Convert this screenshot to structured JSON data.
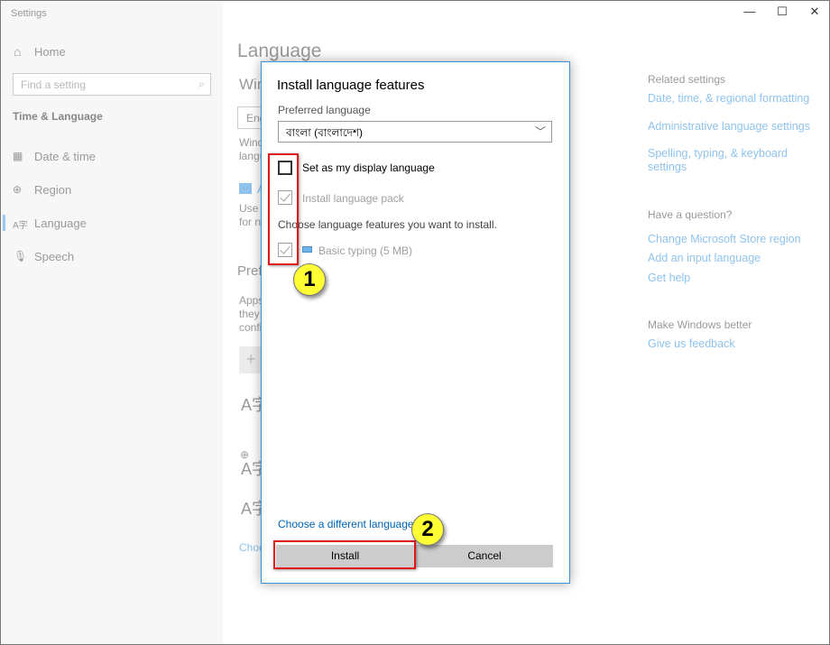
{
  "window": {
    "title": "Settings",
    "controls": {
      "minimize": "—",
      "maximize": "☐",
      "close": "✕"
    }
  },
  "sidebar": {
    "home": "Home",
    "search_placeholder": "Find a setting",
    "section": "Time & Language",
    "items": [
      {
        "label": "Date & time",
        "icon": "calendar-clock-icon"
      },
      {
        "label": "Region",
        "icon": "globe-icon"
      },
      {
        "label": "Language",
        "icon": "language-icon",
        "active": true
      },
      {
        "label": "Speech",
        "icon": "microphone-icon"
      }
    ]
  },
  "main": {
    "title": "Language",
    "fragments": {
      "win": "Win",
      "eng": "Eng",
      "wind": "Wind",
      "langu": "langu",
      "a": "A",
      "use": "Use l",
      "forn": "for n",
      "pref": "Pref",
      "apps": "Apps",
      "they": "they",
      "confi": "confi",
      "plus": "+",
      "choo": "Choo",
      "lang_glyph": "A字"
    }
  },
  "related": {
    "heading": "Related settings",
    "links": [
      "Date, time, & regional formatting",
      "Administrative language settings",
      "Spelling, typing, & keyboard settings"
    ],
    "question_heading": "Have a question?",
    "question_links": [
      "Change Microsoft Store region",
      "Add an input language",
      "Get help"
    ],
    "better_heading": "Make Windows better",
    "better_links": [
      "Give us feedback"
    ]
  },
  "dialog": {
    "title": "Install language features",
    "preferred_label": "Preferred language",
    "preferred_value": "বাংলা (বাংলাদেশ)",
    "display_language": {
      "label": "Set as my display language",
      "checked": false
    },
    "language_pack": {
      "label": "Install language pack",
      "checked": true,
      "disabled": true
    },
    "features_prompt": "Choose language features you want to install.",
    "basic_typing": {
      "label": "Basic typing (5 MB)",
      "checked": true,
      "disabled": true
    },
    "different_link": "Choose a different language",
    "install": "Install",
    "cancel": "Cancel"
  },
  "annotations": {
    "step1": "1",
    "step2": "2",
    "highlight_color": "#e0161b",
    "badge_color": "#ffff33"
  }
}
